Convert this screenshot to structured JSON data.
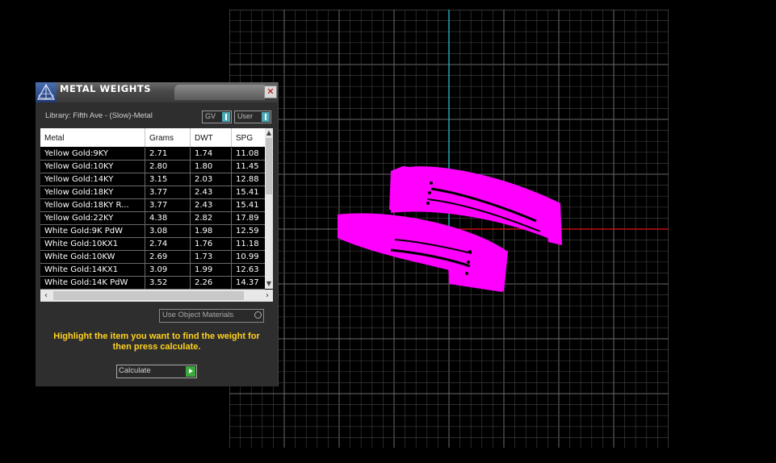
{
  "panel": {
    "title": "METAL WEIGHTS",
    "library": "Library: Fifth Ave - (Slow)-Metal",
    "toggle_gv": "GV",
    "toggle_user": "User",
    "use_object_materials": "Use Object Materials",
    "hint": "Highlight the item you want to find the weight for then press calculate.",
    "calculate": "Calculate",
    "close_glyph": "✕"
  },
  "table": {
    "columns": [
      "Metal",
      "Grams",
      "DWT",
      "SPG"
    ],
    "rows": [
      [
        "Yellow Gold:9KY",
        "2.71",
        "1.74",
        "11.08"
      ],
      [
        "Yellow Gold:10KY",
        "2.80",
        "1.80",
        "11.45"
      ],
      [
        "Yellow Gold:14KY",
        "3.15",
        "2.03",
        "12.88"
      ],
      [
        "Yellow Gold:18KY",
        "3.77",
        "2.43",
        "15.41"
      ],
      [
        "Yellow Gold:18KY R...",
        "3.77",
        "2.43",
        "15.41"
      ],
      [
        "Yellow Gold:22KY",
        "4.38",
        "2.82",
        "17.89"
      ],
      [
        "White Gold:9K PdW",
        "3.08",
        "1.98",
        "12.59"
      ],
      [
        "White Gold:10KX1",
        "2.74",
        "1.76",
        "11.18"
      ],
      [
        "White Gold:10KW",
        "2.69",
        "1.73",
        "10.99"
      ],
      [
        "White Gold:14KX1",
        "3.09",
        "1.99",
        "12.63"
      ],
      [
        "White Gold:14K PdW",
        "3.52",
        "2.26",
        "14.37"
      ]
    ]
  },
  "colors": {
    "ring": "#ff00ff",
    "grid_minor": "#3a3a3a",
    "grid_major": "#6a6a6a",
    "axis_y": "#1fa5b5",
    "axis_x": "#c01010",
    "hint": "#ffd21f"
  },
  "icons": {
    "logo": "pyramid-logo-icon",
    "close": "close-icon"
  }
}
